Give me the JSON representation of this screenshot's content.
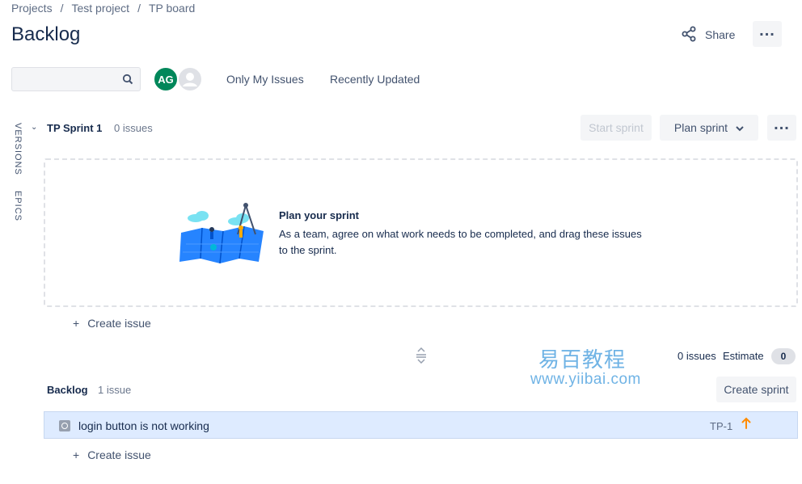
{
  "breadcrumbs": [
    "Projects",
    "Test project",
    "TP board"
  ],
  "page": {
    "title": "Backlog"
  },
  "header": {
    "share_label": "Share"
  },
  "toolbar": {
    "search_placeholder": "",
    "avatar_initials": "AG",
    "quick_filters": [
      "Only My Issues",
      "Recently Updated"
    ]
  },
  "side_tabs": [
    "VERSIONS",
    "EPICS"
  ],
  "sprint": {
    "name": "TP Sprint 1",
    "issue_count": "0 issues",
    "start_label": "Start sprint",
    "plan_label": "Plan sprint",
    "empty_title": "Plan your sprint",
    "empty_text": "As a team, agree on what work needs to be completed, and drag these issues to the sprint.",
    "create_issue": "Create issue"
  },
  "watermark": {
    "cn": "易百教程",
    "url": "www.yiibai.com"
  },
  "backlog": {
    "title": "Backlog",
    "issue_count": "1 issue",
    "summary_count": "0 issues",
    "estimate_label": "Estimate",
    "estimate_value": "0",
    "create_sprint_label": "Create sprint",
    "create_issue": "Create issue",
    "issues": [
      {
        "summary": "login button is not working",
        "key": "TP-1",
        "type_icon": "task-icon",
        "priority_icon": "priority-high-arrow-icon",
        "priority_color": "#ff8b00"
      }
    ]
  },
  "colors": {
    "accent": "#0052cc",
    "selected_row": "#deebff",
    "avatar_bg": "#00875a"
  }
}
